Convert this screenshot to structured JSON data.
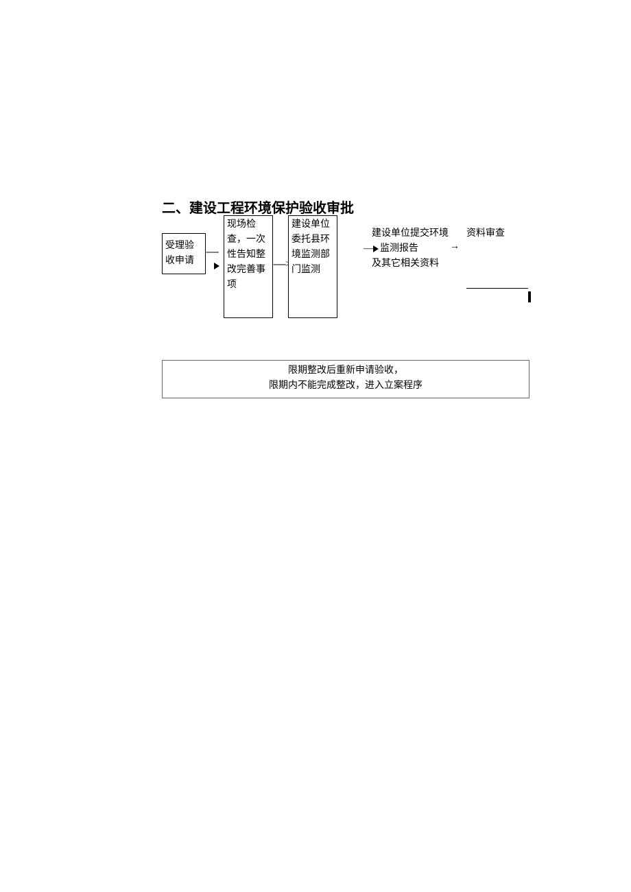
{
  "title": "二、建设工程环境保护验收审批",
  "flowchart": {
    "box1": "受理验收申请",
    "box2": "现场检查，一次性告知整改完善事项",
    "box3": "建设单位委托县环境监测部门监测",
    "text4_line1": "建设单位提交环境",
    "text4_line2": "监测报告",
    "text4_line3": "及其它相关资料",
    "text5": "资料审查"
  },
  "connectors": {
    "dash1": "-----",
    "dash2": "----->",
    "arrow_prefix": "—",
    "arrow_mid": "→"
  },
  "bottom_box": {
    "line1": "限期整改后重新申请验收，",
    "line2": "限期内不能完成整改，进入立案程序"
  }
}
